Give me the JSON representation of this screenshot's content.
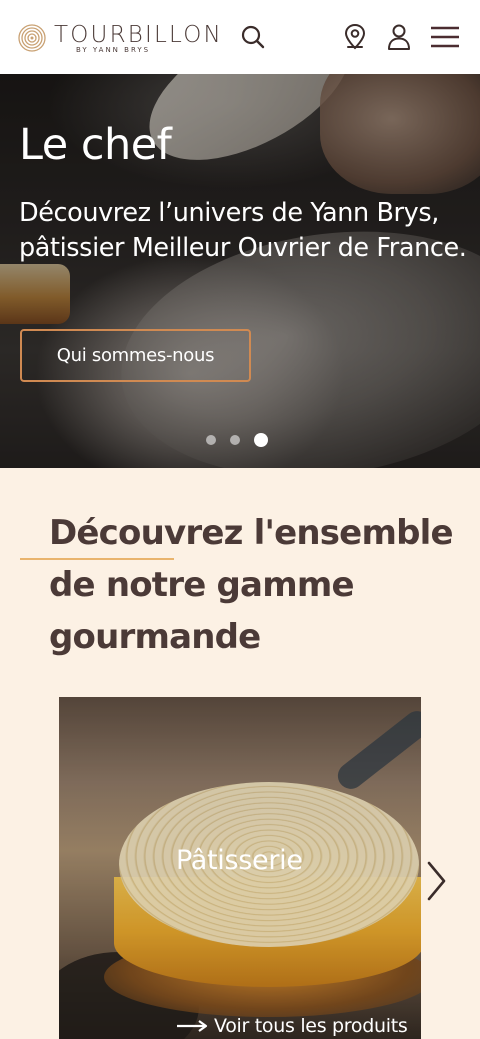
{
  "header": {
    "brand": "TOURBILLON",
    "brand_sub": "BY YANN BRYS",
    "icons": [
      "search-icon",
      "location-pin-icon",
      "user-icon",
      "menu-icon"
    ]
  },
  "hero": {
    "title": "Le chef",
    "text": "Découvrez l’univers de Yann Brys, pâtissier Meilleur Ouvrier de France.",
    "button_label": "Qui sommes-nous",
    "slides_total": 3,
    "active_slide": 3
  },
  "range": {
    "title": "Découvrez l'ensemble de notre gamme gourmande",
    "card_label": "Pâtisserie",
    "card_link": "Voir tous les produits"
  },
  "colors": {
    "accent": "#d08a52",
    "accent_line": "#e9b46d",
    "text_dark": "#4b3a37",
    "section_bg": "#fcf1e4"
  }
}
